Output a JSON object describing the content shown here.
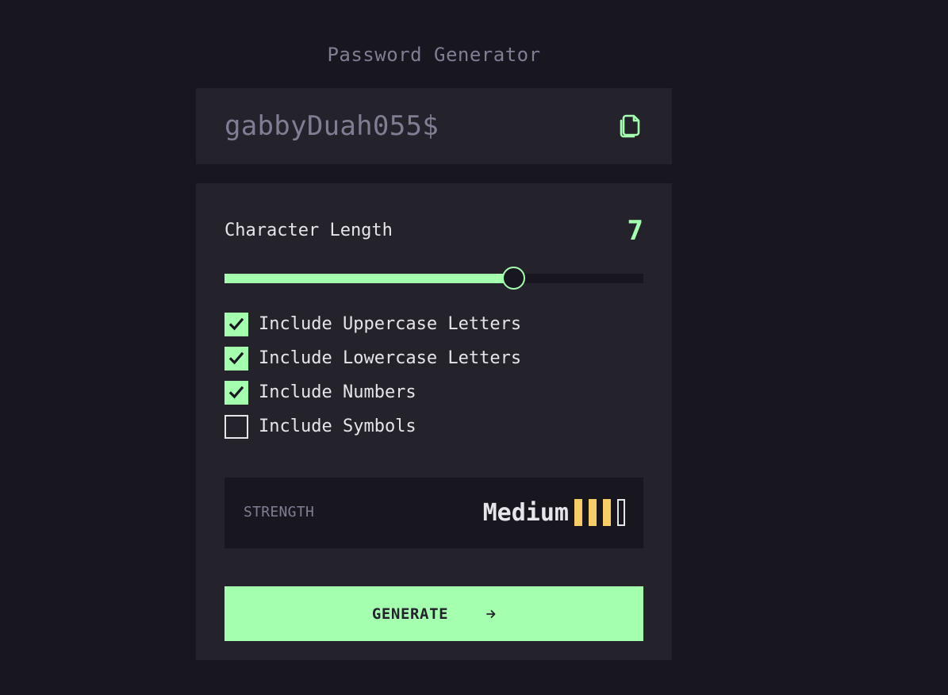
{
  "app": {
    "title": "Password Generator"
  },
  "output": {
    "password": "gabbyDuah055$",
    "copy_icon": "copy-icon"
  },
  "length": {
    "label": "Character Length",
    "value": "7",
    "slider_fraction": 0.69
  },
  "options": [
    {
      "label": "Include Uppercase Letters",
      "checked": true
    },
    {
      "label": "Include Lowercase Letters",
      "checked": true
    },
    {
      "label": "Include Numbers",
      "checked": true
    },
    {
      "label": "Include Symbols",
      "checked": false
    }
  ],
  "strength": {
    "label": "STRENGTH",
    "value": "Medium",
    "level": 3,
    "max_level": 4
  },
  "generate": {
    "label": "GENERATE",
    "icon": "arrow-right-icon"
  },
  "colors": {
    "background": "#18171f",
    "panel": "#24232c",
    "accent": "#a4ffaf",
    "muted": "#817d92",
    "text": "#e6e5ea",
    "strength_medium": "#f8cd65"
  }
}
